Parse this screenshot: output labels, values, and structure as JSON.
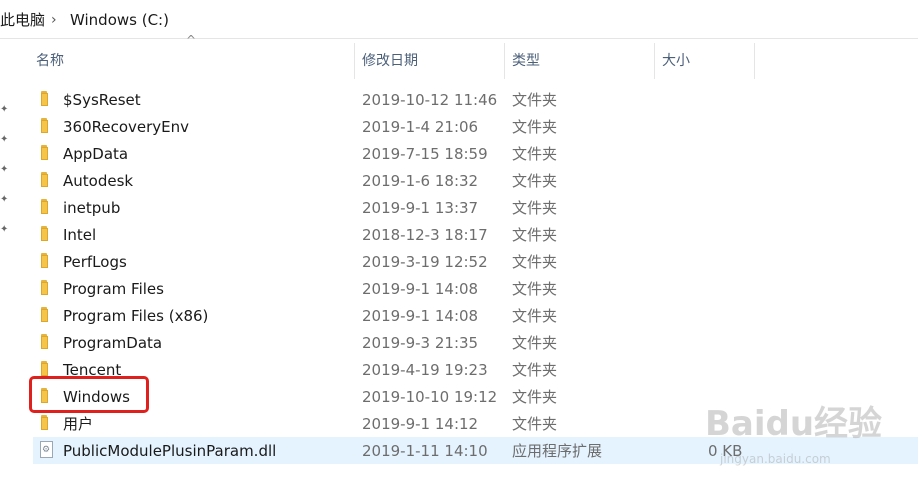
{
  "breadcrumb": {
    "root": "此电脑",
    "separator": "›",
    "current": "Windows (C:)"
  },
  "columns": {
    "name": "名称",
    "modified": "修改日期",
    "type": "类型",
    "size": "大小"
  },
  "rows": [
    {
      "name": "$SysReset",
      "modified": "2019-10-12 11:46",
      "type": "文件夹",
      "size": "",
      "icon": "folder-icon"
    },
    {
      "name": "360RecoveryEnv",
      "modified": "2019-1-4 21:06",
      "type": "文件夹",
      "size": "",
      "icon": "folder-icon"
    },
    {
      "name": "AppData",
      "modified": "2019-7-15 18:59",
      "type": "文件夹",
      "size": "",
      "icon": "folder-icon"
    },
    {
      "name": "Autodesk",
      "modified": "2019-1-6 18:32",
      "type": "文件夹",
      "size": "",
      "icon": "folder-icon"
    },
    {
      "name": "inetpub",
      "modified": "2019-9-1 13:37",
      "type": "文件夹",
      "size": "",
      "icon": "folder-icon"
    },
    {
      "name": "Intel",
      "modified": "2018-12-3 18:17",
      "type": "文件夹",
      "size": "",
      "icon": "folder-icon"
    },
    {
      "name": "PerfLogs",
      "modified": "2019-3-19 12:52",
      "type": "文件夹",
      "size": "",
      "icon": "folder-icon"
    },
    {
      "name": "Program Files",
      "modified": "2019-9-1 14:08",
      "type": "文件夹",
      "size": "",
      "icon": "folder-icon"
    },
    {
      "name": "Program Files (x86)",
      "modified": "2019-9-1 14:08",
      "type": "文件夹",
      "size": "",
      "icon": "folder-icon"
    },
    {
      "name": "ProgramData",
      "modified": "2019-9-3 21:35",
      "type": "文件夹",
      "size": "",
      "icon": "folder-icon"
    },
    {
      "name": "Tencent",
      "modified": "2019-4-19 19:23",
      "type": "文件夹",
      "size": "",
      "icon": "folder-icon"
    },
    {
      "name": "Windows",
      "modified": "2019-10-10 19:12",
      "type": "文件夹",
      "size": "",
      "icon": "folder-icon",
      "highlighted": true
    },
    {
      "name": "用户",
      "modified": "2019-9-1 14:12",
      "type": "文件夹",
      "size": "",
      "icon": "folder-icon"
    },
    {
      "name": "PublicModulePlusinParam.dll",
      "modified": "2019-1-11 14:10",
      "type": "应用程序扩展",
      "size": "0 KB",
      "icon": "dll-file-icon",
      "selected": true
    }
  ],
  "watermark": {
    "brand": "Baidu经验",
    "url": "jingyan.baidu.com"
  },
  "colors": {
    "selection": "#e5f3ff",
    "highlight_border": "#e0201c",
    "header_text": "#4c607a",
    "folder": "#f5c54a"
  }
}
